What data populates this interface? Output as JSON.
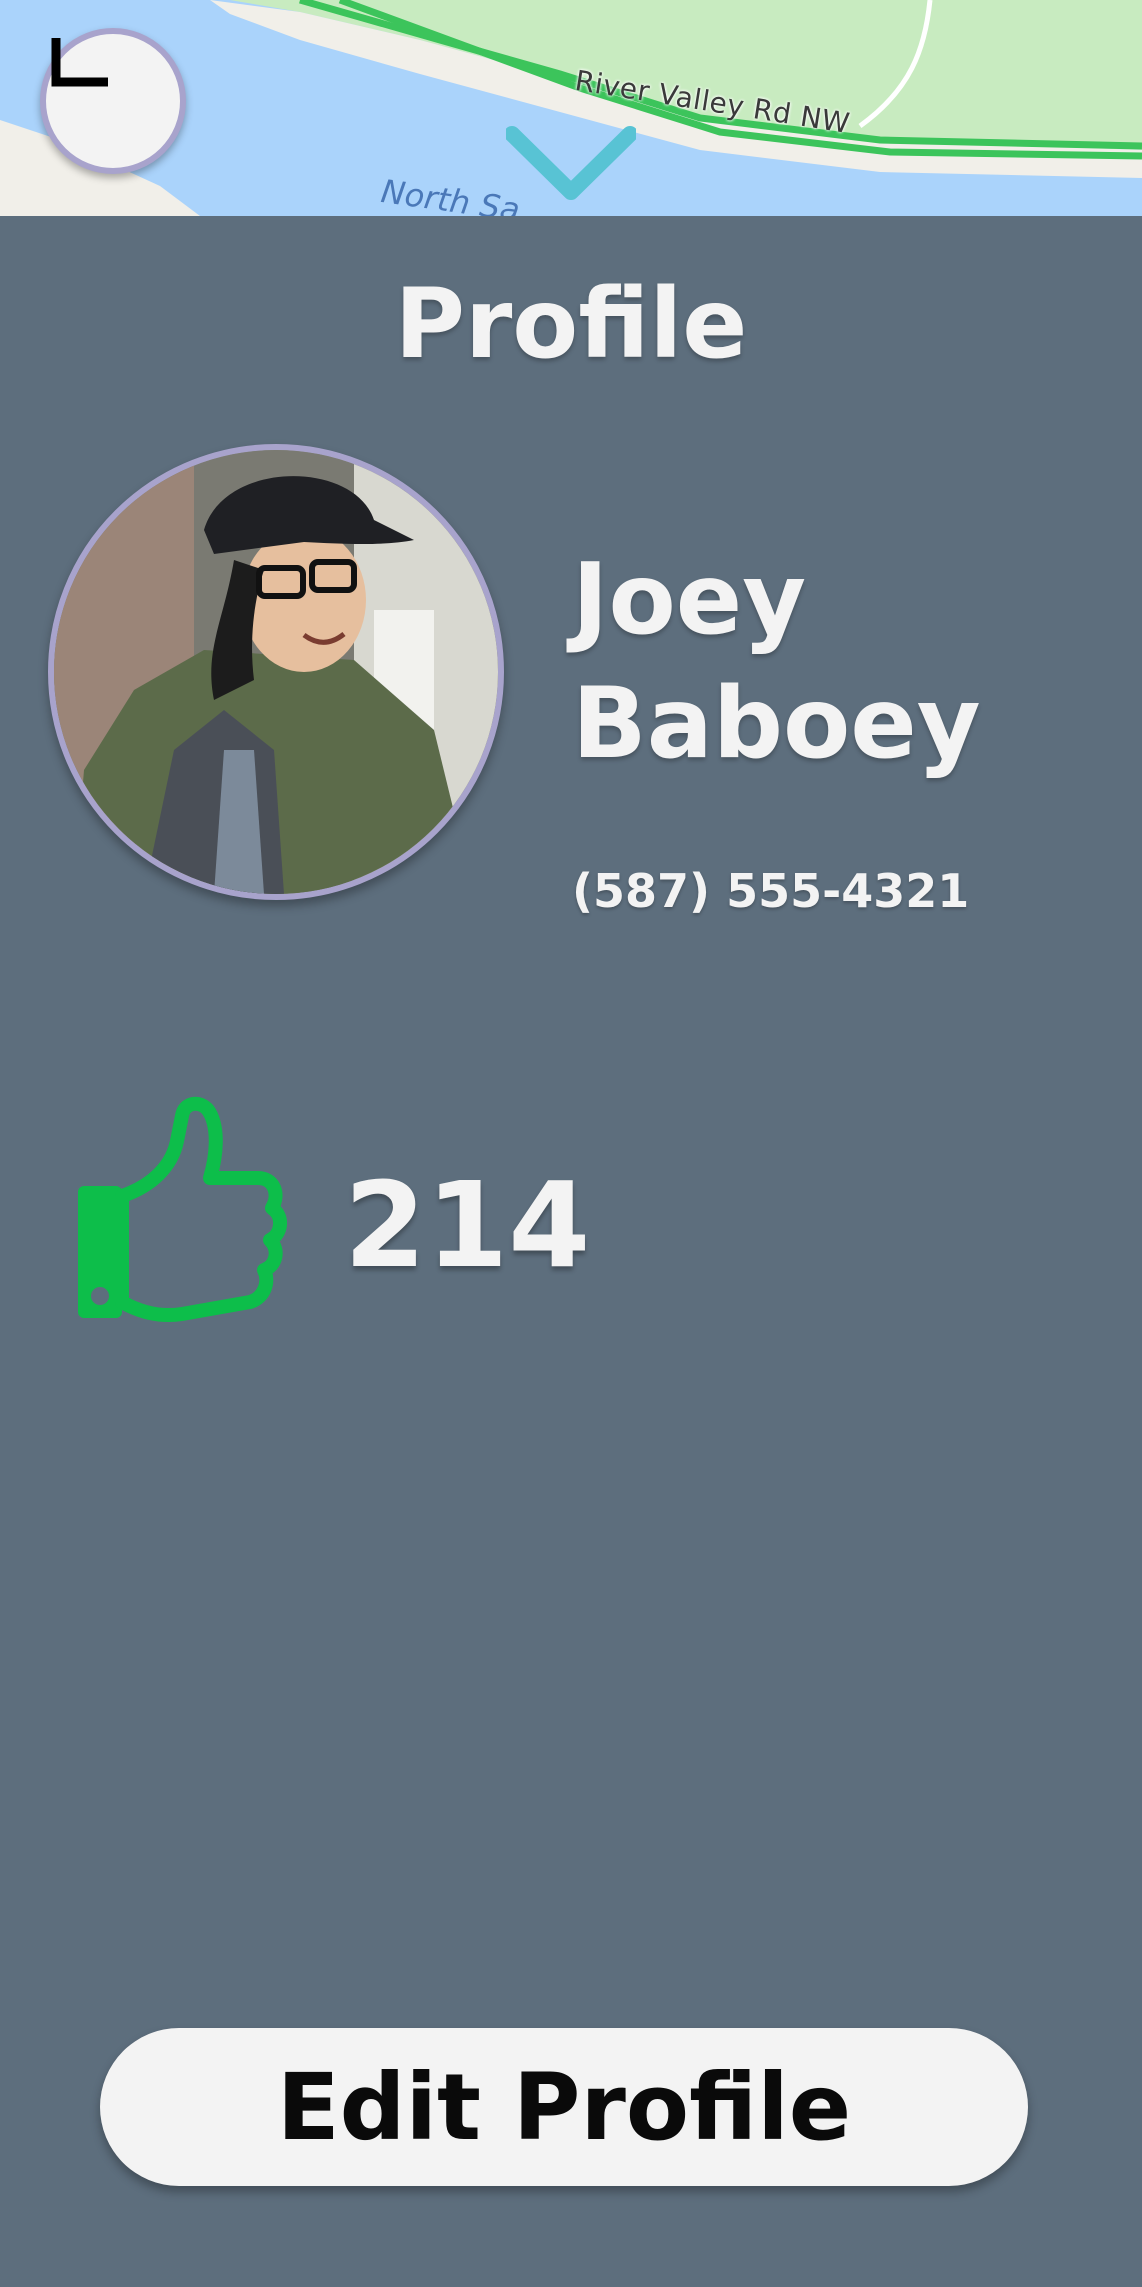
{
  "map": {
    "road_label": "River Valley Rd NW",
    "water_label": "North Sa",
    "history_icon": "clock-icon",
    "collapse_icon": "chevron-down-icon"
  },
  "profile": {
    "title": "Profile",
    "first_name": "Joey",
    "last_name": "Baboey",
    "phone": "(587) 555-4321",
    "likes_icon": "thumbs-up-icon",
    "likes_count": "214",
    "edit_button_label": "Edit Profile"
  },
  "colors": {
    "panel_background": "#5d6e7d",
    "text": "#f3f3f3",
    "accent_green": "#0dbe4a",
    "ring_lavender": "#a8a3cc",
    "chevron_teal": "#58c3d4",
    "button_background": "#f3f3f3"
  }
}
